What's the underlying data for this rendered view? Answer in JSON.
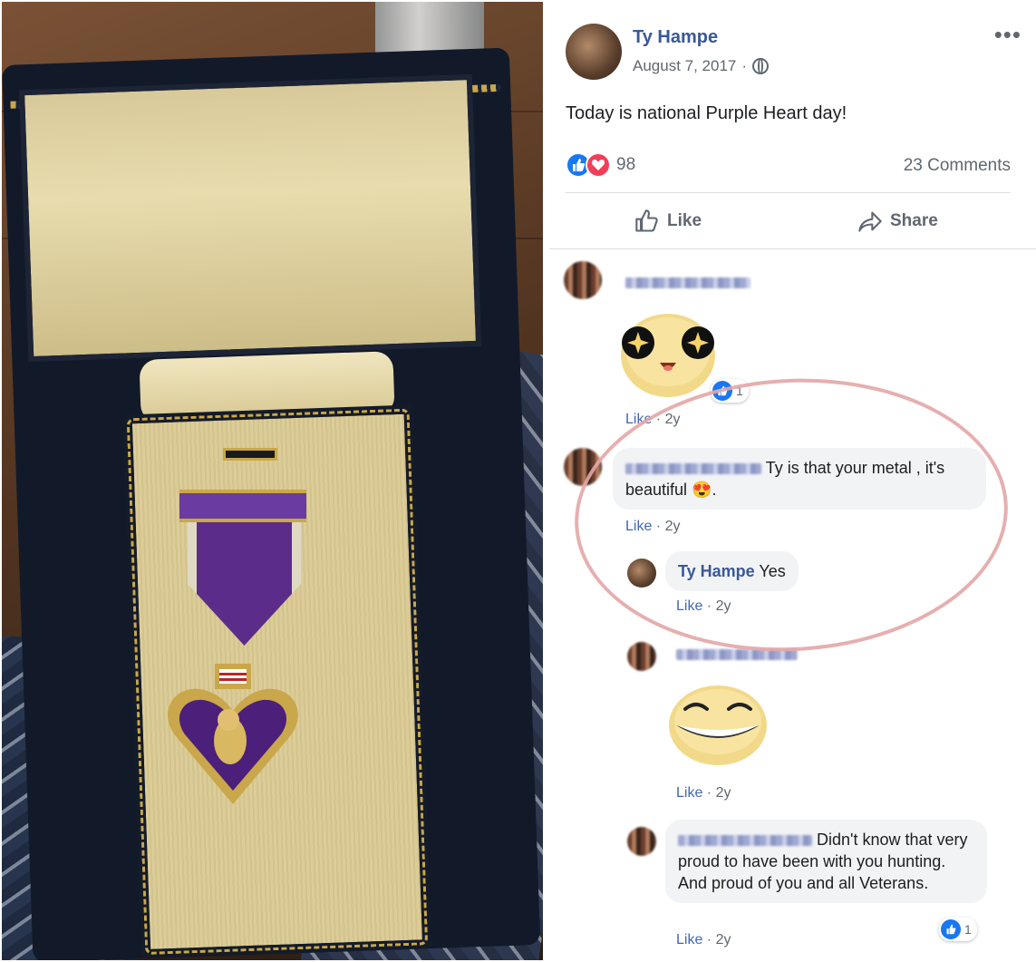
{
  "post": {
    "author": "Ty Hampe",
    "date": "August 7, 2017",
    "date_separator": "·",
    "more_label": "•••",
    "text": "Today is national Purple Heart day!",
    "reaction_count": "98",
    "comments_count": "23 Comments",
    "actions": {
      "like": "Like",
      "share": "Share"
    }
  },
  "comments": [
    {
      "meta_like": "Like",
      "meta_time": "2y",
      "reaction_count": "1",
      "sticker": "star-eyes-sticker"
    },
    {
      "text": "Ty is that your metal , it's beautiful",
      "emoji": "😍",
      "tail": ".",
      "meta_like": "Like",
      "meta_time": "2y"
    },
    {
      "name": "Ty Hampe",
      "text": "Yes",
      "meta_like": "Like",
      "meta_time": "2y"
    },
    {
      "meta_like": "Like",
      "meta_time": "2y",
      "sticker": "grin-sticker"
    },
    {
      "text": "Didn't know that very proud to have been with you hunting. And proud of you and all Veterans.",
      "meta_like": "Like",
      "meta_time": "2y",
      "reaction_count": "1"
    }
  ],
  "colors": {
    "link": "#385898",
    "like_blue": "#1877f2",
    "love_red": "#f33e58",
    "annotation": "#e3a6a6"
  }
}
